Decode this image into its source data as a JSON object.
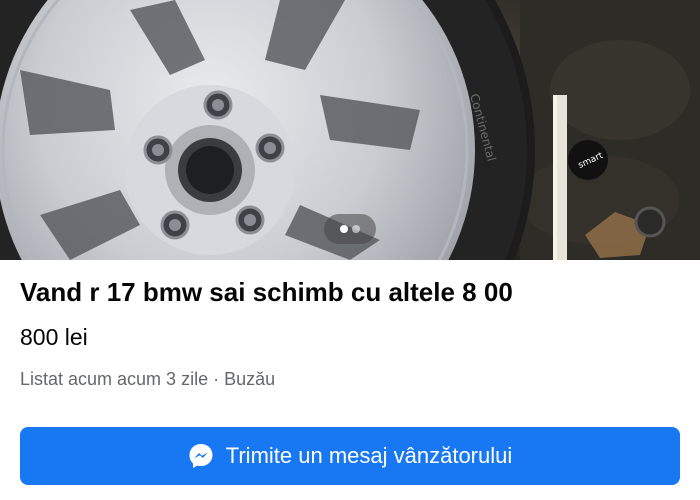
{
  "photo": {
    "description_icon": "wheel-photo",
    "tire_sidewall_text": "Continental",
    "sticker_text": "smart",
    "pager": {
      "active_index": 1,
      "total": 2
    }
  },
  "listing": {
    "title": "Vand r 17 bmw sai schimb cu altele 8 00",
    "price": "800 lei",
    "meta": "Listat acum acum 3 zile · Buzău"
  },
  "actions": {
    "message_button_label": "Trimite un mesaj vânzătorului",
    "message_icon": "messenger-icon"
  },
  "colors": {
    "accent": "#1877f2",
    "title_text": "#050505",
    "secondary_text": "#65676b",
    "button_text": "#ffffff"
  }
}
